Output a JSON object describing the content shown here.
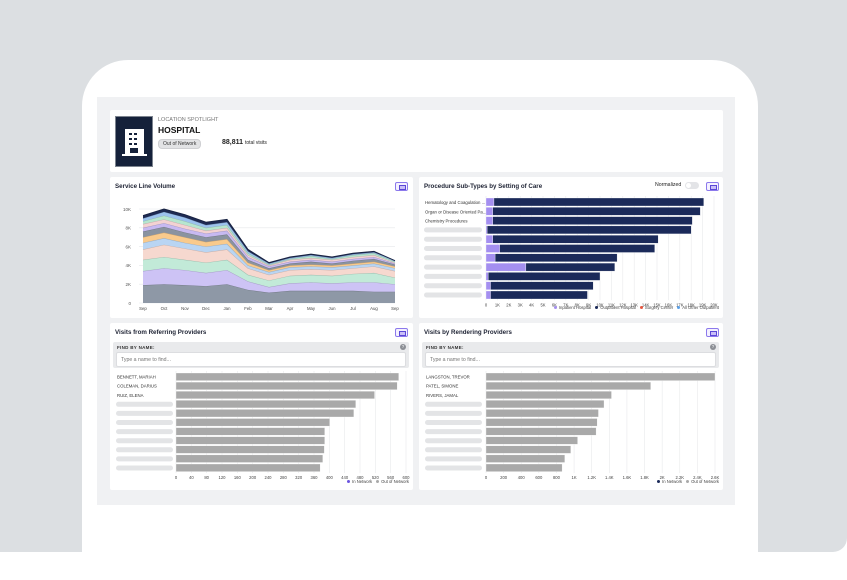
{
  "header": {
    "eyebrow": "LOCATION SPOTLIGHT",
    "title": "HOSPITAL",
    "badge": "Out of Network",
    "visits_value": "88,811",
    "visits_label": "total visits",
    "icon": "hospital-building-icon"
  },
  "colors": {
    "brand_navy": "#15213a",
    "accent": "#6b55e0"
  },
  "chart_data": [
    {
      "type": "area",
      "title": "Service Line Volume",
      "stacked": true,
      "categories": [
        "Sep",
        "Oct",
        "Nov",
        "Dec",
        "Jan",
        "Feb",
        "Mar",
        "Apr",
        "May",
        "Jun",
        "Jul",
        "Aug",
        "Sep"
      ],
      "yticks": [
        "0",
        "2K",
        "4K",
        "6K",
        "8K",
        "10K"
      ],
      "ylim": [
        0,
        10000
      ],
      "grid": true,
      "series": [
        {
          "color": "#8e98a6",
          "values": [
            1900,
            2000,
            1900,
            1800,
            2000,
            1400,
            1100,
            1300,
            1300,
            1300,
            1300,
            1200,
            1200
          ]
        },
        {
          "color": "#cdc3f5",
          "values": [
            1500,
            1700,
            1600,
            1400,
            1500,
            900,
            600,
            800,
            900,
            800,
            900,
            1000,
            800
          ]
        },
        {
          "color": "#c2ead8",
          "values": [
            1200,
            1200,
            1100,
            1100,
            1100,
            700,
            700,
            800,
            800,
            800,
            900,
            1000,
            700
          ]
        },
        {
          "color": "#f6d8cf",
          "values": [
            1100,
            1300,
            1200,
            1100,
            1100,
            700,
            600,
            600,
            600,
            600,
            600,
            700,
            700
          ]
        },
        {
          "color": "#b9d5f3",
          "values": [
            700,
            700,
            600,
            600,
            600,
            300,
            300,
            300,
            300,
            300,
            300,
            300,
            300
          ]
        },
        {
          "color": "#f9ca8c",
          "values": [
            600,
            600,
            600,
            500,
            500,
            300,
            200,
            200,
            200,
            200,
            200,
            200,
            200
          ]
        },
        {
          "color": "#8a93a0",
          "values": [
            600,
            600,
            500,
            500,
            500,
            300,
            200,
            200,
            300,
            200,
            300,
            300,
            200
          ]
        },
        {
          "color": "#c7b9f1",
          "values": [
            400,
            400,
            400,
            400,
            400,
            300,
            200,
            200,
            200,
            200,
            200,
            200,
            100
          ]
        },
        {
          "color": "#f3d2d2",
          "values": [
            400,
            400,
            400,
            300,
            300,
            200,
            100,
            200,
            200,
            200,
            200,
            200,
            100
          ]
        },
        {
          "color": "#b6e6cf",
          "values": [
            300,
            400,
            400,
            300,
            300,
            200,
            100,
            100,
            200,
            100,
            200,
            200,
            100
          ]
        },
        {
          "color": "#9cc2ee",
          "values": [
            300,
            400,
            400,
            300,
            300,
            200,
            100,
            100,
            100,
            100,
            100,
            100,
            100
          ]
        },
        {
          "color": "#1e2a52",
          "values": [
            300,
            300,
            300,
            300,
            300,
            200,
            100,
            100,
            100,
            100,
            100,
            100,
            0
          ]
        }
      ]
    },
    {
      "type": "bar",
      "orientation": "horizontal",
      "stacked": true,
      "title": "Procedure Sub-Types by Setting of Care",
      "toggle_label": "Normalized",
      "toggle_on": false,
      "categories": [
        "Hematology and Coagulation ...",
        "Organ or Disease Oriented Pa...",
        "Chemistry Procedures",
        "",
        "",
        "",
        "",
        "",
        "",
        "",
        ""
      ],
      "xticks": [
        "0",
        "1K",
        "2K",
        "3K",
        "4K",
        "5K",
        "6K",
        "7K",
        "8K",
        "9K",
        "10K",
        "11K",
        "12K",
        "13K",
        "14K",
        "15K",
        "16K",
        "17K",
        "18K",
        "19K",
        "20K"
      ],
      "xlim": [
        0,
        20000
      ],
      "legend_position": "bottom-right",
      "series": [
        {
          "name": "Inpatient Hospital",
          "color": "#a48ff0",
          "values": [
            700,
            600,
            600,
            100,
            600,
            1200,
            800,
            3500,
            200,
            400,
            400
          ]
        },
        {
          "name": "Outpatient Hospital",
          "color": "#1b2a5a",
          "values": [
            18400,
            18200,
            17500,
            17900,
            14500,
            13600,
            10700,
            7800,
            9800,
            9000,
            8500
          ]
        },
        {
          "name": "Surgery Center",
          "color": "#e8553f",
          "values": [
            0,
            0,
            0,
            0,
            0,
            0,
            0,
            0,
            0,
            0,
            0
          ]
        },
        {
          "name": "All Other Outpatient",
          "color": "#5aa0e8",
          "values": [
            0,
            0,
            0,
            0,
            0,
            0,
            0,
            0,
            0,
            0,
            0
          ]
        }
      ]
    },
    {
      "type": "bar",
      "orientation": "horizontal",
      "title": "Visits from Referring Providers",
      "search_label": "FIND BY NAME:",
      "search_placeholder": "Type a name to find...",
      "categories": [
        "BENNETT, MARIAH",
        "COLEMAN, DARIUS",
        "RUIZ, ELENA",
        "",
        "",
        "",
        "",
        "",
        "",
        "",
        ""
      ],
      "xticks": [
        "0",
        "40",
        "80",
        "120",
        "160",
        "200",
        "240",
        "280",
        "320",
        "360",
        "400",
        "440",
        "480",
        "520",
        "560",
        "600"
      ],
      "xlim": [
        0,
        600
      ],
      "legend_position": "bottom-right",
      "series": [
        {
          "name": "In Network",
          "color": "#6b55e0",
          "values": [
            0,
            0,
            0,
            0,
            0,
            0,
            0,
            0,
            0,
            0,
            0
          ]
        },
        {
          "name": "Out of Network",
          "color": "#a9a9a9",
          "values": [
            581,
            577,
            518,
            469,
            464,
            401,
            388,
            388,
            387,
            383,
            376
          ]
        }
      ]
    },
    {
      "type": "bar",
      "orientation": "horizontal",
      "title": "Visits by Rendering Providers",
      "search_label": "FIND BY NAME:",
      "search_placeholder": "Type a name to find...",
      "categories": [
        "LANGSTON, TREVOR",
        "PATEL, SIMONE",
        "RIVERS, JAMAL",
        "",
        "",
        "",
        "",
        "",
        "",
        "",
        ""
      ],
      "xticks": [
        "0",
        "200",
        "400",
        "600",
        "800",
        "1K",
        "1.2K",
        "1.4K",
        "1.6K",
        "1.8K",
        "2K",
        "2.2K",
        "2.4K",
        "2.6K"
      ],
      "xlim": [
        0,
        2600
      ],
      "legend_position": "bottom-right",
      "series": [
        {
          "name": "In Network",
          "color": "#1b2a5a",
          "values": [
            0,
            0,
            0,
            0,
            0,
            0,
            0,
            0,
            0,
            0,
            0
          ]
        },
        {
          "name": "Out of Network",
          "color": "#a9a9a9",
          "values": [
            2600,
            1870,
            1425,
            1340,
            1277,
            1262,
            1250,
            1040,
            963,
            895,
            864
          ]
        }
      ]
    }
  ]
}
